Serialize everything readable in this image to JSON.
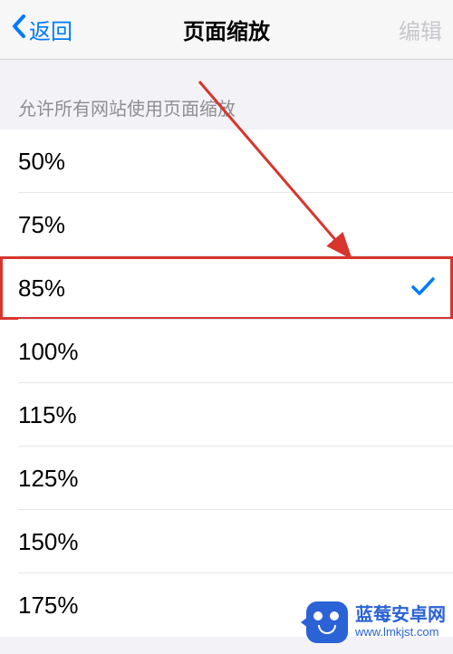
{
  "nav": {
    "back_label": "返回",
    "title": "页面缩放",
    "edit_label": "编辑"
  },
  "section": {
    "header": "允许所有网站使用页面缩放"
  },
  "options": [
    {
      "label": "50%",
      "selected": false,
      "highlighted": false
    },
    {
      "label": "75%",
      "selected": false,
      "highlighted": false
    },
    {
      "label": "85%",
      "selected": true,
      "highlighted": true
    },
    {
      "label": "100%",
      "selected": false,
      "highlighted": false
    },
    {
      "label": "115%",
      "selected": false,
      "highlighted": false
    },
    {
      "label": "125%",
      "selected": false,
      "highlighted": false
    },
    {
      "label": "150%",
      "selected": false,
      "highlighted": false
    },
    {
      "label": "175%",
      "selected": false,
      "highlighted": false
    }
  ],
  "watermark": {
    "title": "蓝莓安卓网",
    "url": "www.lmkjst.com"
  },
  "colors": {
    "accent": "#007aff",
    "annotation": "#d7352d",
    "watermark_brand": "#2b62d6"
  }
}
